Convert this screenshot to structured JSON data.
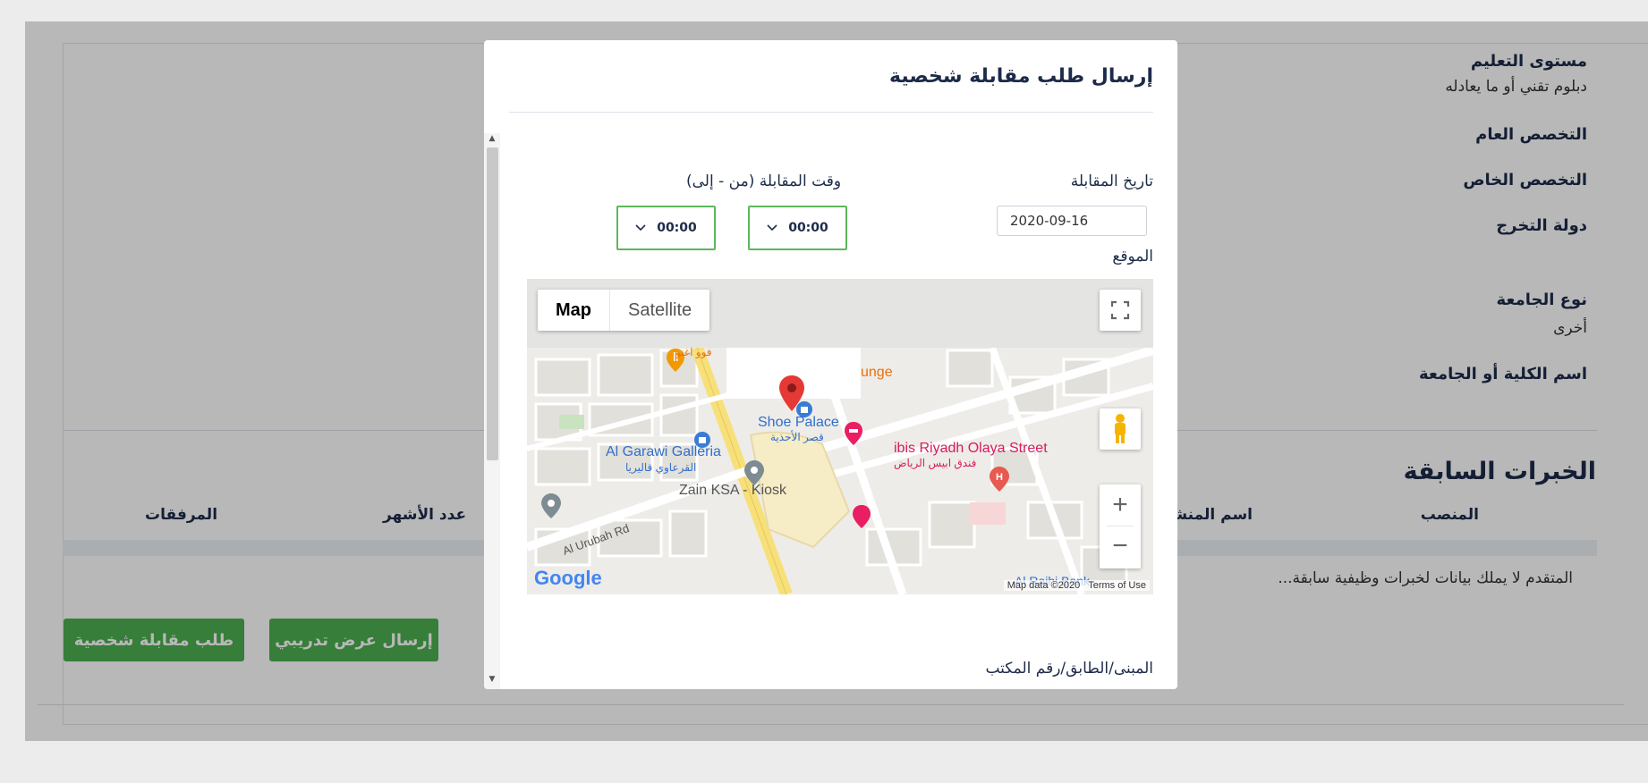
{
  "profile": {
    "education_label": "مستوى التعليم",
    "education_value": "دبلوم تقني أو ما يعادله",
    "general_major_label": "التخصص العام",
    "special_major_label": "التخصص الخاص",
    "graduation_country_label": "دولة التخرج",
    "university_type_label": "نوع الجامعة",
    "university_type_value": "أخرى",
    "college_name_label": "اسم الكلية أو الجامعة"
  },
  "experience": {
    "title": "الخبرات السابقة",
    "columns": [
      "المنصب",
      "اسم المنشأة",
      "عدد الأشهر",
      "المرفقات"
    ],
    "empty_message": "المتقدم لا يملك بيانات لخبرات وظيفية سابقة..."
  },
  "actions": {
    "send_training_offer": "إرسال عرض تدريبي",
    "request_interview": "طلب مقابلة شخصية"
  },
  "modal": {
    "title": "إرسال طلب مقابلة شخصية",
    "date_label": "تاريخ المقابلة",
    "date_value": "2020-09-16",
    "time_label": "وقت المقابلة (من - إلى)",
    "time_from": "00:00",
    "time_to": "00:00",
    "location_label": "الموقع",
    "building_label": "المبنى/الطابق/رقم المكتب"
  },
  "map": {
    "tab_map": "Map",
    "tab_satellite": "Satellite",
    "places": {
      "shoe_palace": "Shoe Palace",
      "shoe_palace_ar": "قصر الأحذية",
      "al_garawi": "Al Garawi Galleria",
      "al_garawi_ar": "القرعاوي قاليريا",
      "zain": "Zain KSA - Kiosk",
      "ibis": "ibis Riyadh Olaya Street",
      "ibis_ar": "فندق ابيس الرياض",
      "lounge": "unge",
      "al_rajhi": "Al Rajhi Bank",
      "al_urubah": "Al Urubah Rd",
      "fuego": "فوو اغنو"
    },
    "google": "Google",
    "map_data": "Map data ©2020",
    "terms": "Terms of Use",
    "colors": {
      "road_major": "#f7e07a",
      "road_minor": "#ffffff",
      "block": "#e4e2dd",
      "pin": "#e53935"
    }
  }
}
